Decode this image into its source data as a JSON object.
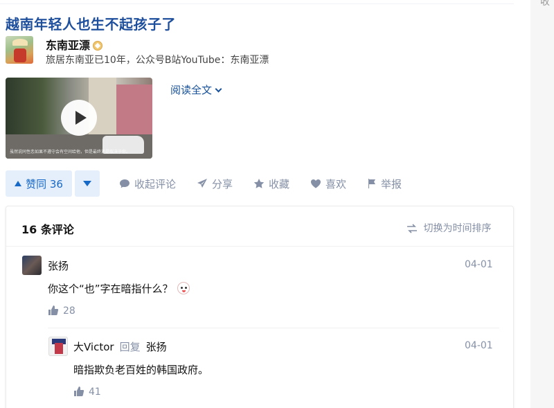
{
  "right_edge_char": "收",
  "article": {
    "title": "越南年轻人也生不起孩子了",
    "author_name": "东南亚漂",
    "author_desc": "旅居东南亚已10年，公众号B站YouTube：东南亚漂",
    "video_caption": "虽然说同性恋如果不遵守会有空间给他，但是最终还是取决于你。",
    "read_more": "阅读全文"
  },
  "actions": {
    "vote_up": "赞同 36",
    "collapse_comments": "收起评论",
    "share": "分享",
    "favorite": "收藏",
    "like": "喜欢",
    "report": "举报"
  },
  "comments": {
    "count_label": "16 条评论",
    "sort_label": "切换为时间排序",
    "items": [
      {
        "author": "张扬",
        "time": "04-01",
        "text": "你这个“也”字在暗指什么？",
        "likes": "28"
      },
      {
        "author": "大Victor",
        "reply_label": "回复",
        "reply_to": "张扬",
        "time": "04-01",
        "text": "暗指欺负老百姓的韩国政府。",
        "likes": "41"
      }
    ]
  },
  "colors": {
    "title": "#1e4f9c",
    "accent": "#1769c7",
    "muted": "#8590a6",
    "vote_bg": "#e5eefb"
  }
}
